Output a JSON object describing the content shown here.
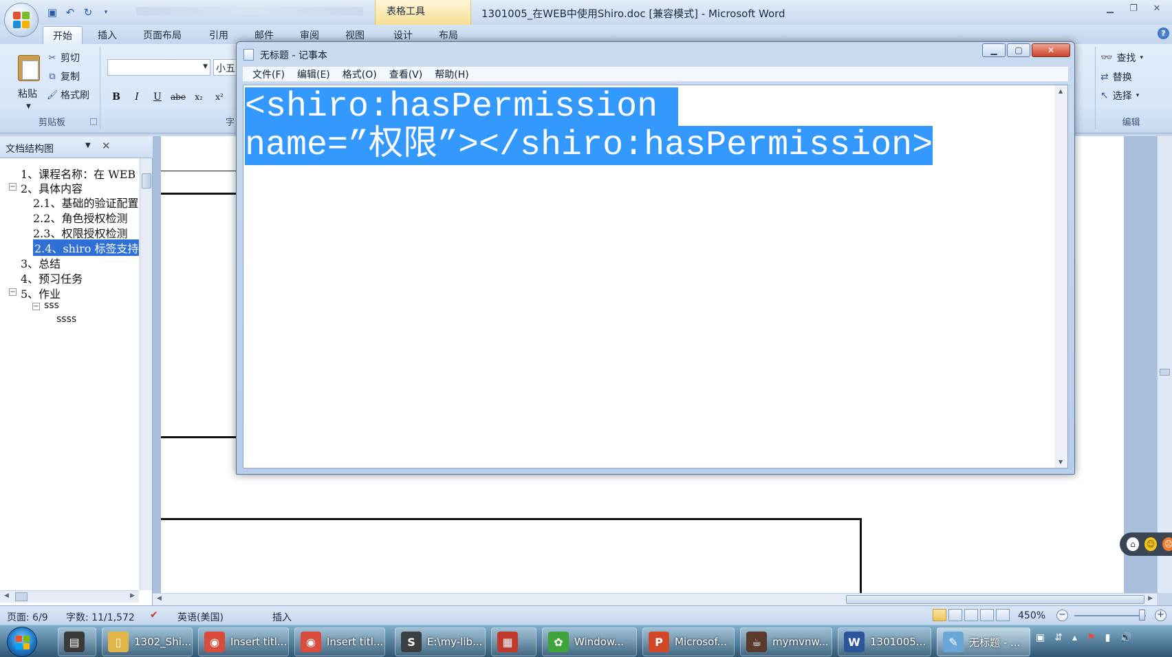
{
  "word": {
    "qat_icons": [
      "save-icon",
      "undo-icon",
      "redo-icon"
    ],
    "context_tab": "表格工具",
    "window_title": "1301005_在WEB中使用Shiro.doc [兼容模式] - Microsoft Word",
    "tabs": [
      "开始",
      "插入",
      "页面布局",
      "引用",
      "邮件",
      "审阅",
      "视图",
      "设计",
      "布局"
    ],
    "clipboard": {
      "paste": "粘贴",
      "cut": "剪切",
      "copy": "复制",
      "format_painter": "格式刷",
      "group_label": "剪贴板"
    },
    "font": {
      "name_value": "",
      "size_value": "小五",
      "group_label_partial": "字",
      "buttons": [
        "B",
        "I",
        "U",
        "abe",
        "x₂",
        "x²"
      ]
    },
    "editing": {
      "find": "查找",
      "replace": "替换",
      "select": "选择",
      "group_label": "编辑"
    }
  },
  "docmap": {
    "title": "文档结构图",
    "items": [
      {
        "text": "1、课程名称：在 WEB",
        "toggle": ""
      },
      {
        "text": "2、具体内容",
        "toggle": "−"
      },
      {
        "text": "2.1、基础的验证配置",
        "toggle": ""
      },
      {
        "text": "2.2、角色授权检测",
        "toggle": ""
      },
      {
        "text": "2.3、权限授权检测",
        "toggle": ""
      },
      {
        "text": "2.4、shiro 标签支持",
        "toggle": "",
        "selected": true
      },
      {
        "text": "3、总结",
        "toggle": ""
      },
      {
        "text": "4、预习任务",
        "toggle": ""
      },
      {
        "text": "5、作业",
        "toggle": "−"
      },
      {
        "text": "sss",
        "toggle": "−"
      },
      {
        "text": "ssss",
        "toggle": ""
      }
    ]
  },
  "notepad": {
    "title": "无标题 - 记事本",
    "menus": [
      "文件(F)",
      "编辑(E)",
      "格式(O)",
      "查看(V)",
      "帮助(H)"
    ],
    "line1": "<shiro:hasPermission ",
    "line2": "name=”权限”></shiro:hasPermission>"
  },
  "status": {
    "page": "页面: 6/9",
    "words": "字数: 11/1,572",
    "language": "英语(美国)",
    "mode": "插入",
    "zoom": "450%"
  },
  "taskbar": {
    "items": [
      {
        "label": "",
        "icon": "film-icon",
        "color": "#3a3a3a"
      },
      {
        "label": "1302_Shi...",
        "icon": "folder-icon",
        "color": "#e2b548"
      },
      {
        "label": "Insert titl...",
        "icon": "chrome-icon",
        "color": "#d94b3b"
      },
      {
        "label": "Insert titl...",
        "icon": "chrome-icon",
        "color": "#d94b3b"
      },
      {
        "label": "E:\\my-lib...",
        "icon": "sublime-icon",
        "color": "#3c3f41"
      },
      {
        "label": "",
        "icon": "calendar-icon",
        "color": "#c0392b"
      },
      {
        "label": "Window...",
        "icon": "window-icon",
        "color": "#3fa33b"
      },
      {
        "label": "Microsof...",
        "icon": "powerpoint-icon",
        "color": "#d24726"
      },
      {
        "label": "mymvnw...",
        "icon": "javaee-icon",
        "color": "#5a3b2e"
      },
      {
        "label": "1301005...",
        "icon": "word-icon",
        "color": "#2b579a"
      },
      {
        "label": "无标题 - ...",
        "icon": "notepad-icon",
        "color": "#6aa6d8"
      }
    ]
  },
  "colors": {
    "selection": "#3399ff",
    "ribbon": "#d6e5f7",
    "doc_bg": "#a9bfdc"
  }
}
